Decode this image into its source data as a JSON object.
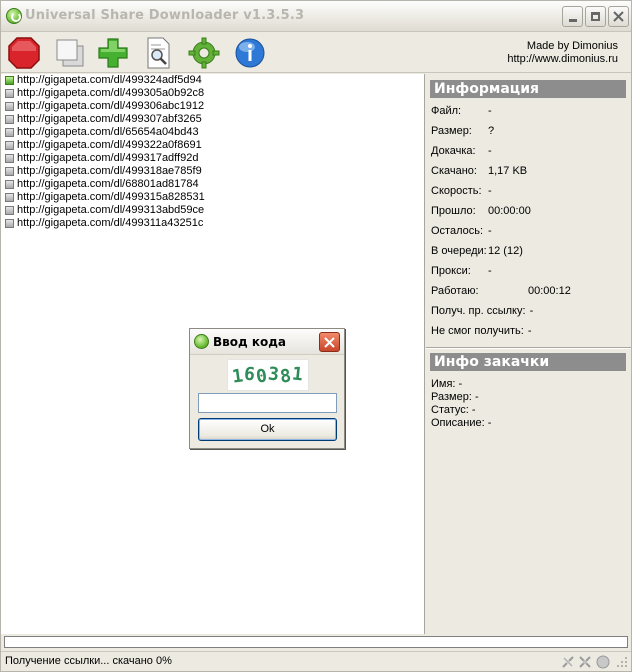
{
  "window": {
    "title": "Universal Share Downloader v1.3.5.3"
  },
  "toolbar": {
    "tools": [
      {
        "name": "stop-icon",
        "color": "#d9242b"
      },
      {
        "name": "copy-icon",
        "color": "#c8c8c8"
      },
      {
        "name": "add-icon",
        "color": "#46b030"
      },
      {
        "name": "search-document-icon",
        "color": "#9aa3b0"
      },
      {
        "name": "settings-gear-icon",
        "color": "#62b23a"
      },
      {
        "name": "globe-info-icon",
        "color": "#2e79d6"
      }
    ],
    "made_by_line1": "Made by Dimonius",
    "made_by_line2": "http://www.dimonius.ru"
  },
  "links": [
    {
      "url": "http://gigapeta.com/dl/499324adf5d94",
      "active": true
    },
    {
      "url": "http://gigapeta.com/dl/499305a0b92c8",
      "active": false
    },
    {
      "url": "http://gigapeta.com/dl/499306abc1912",
      "active": false
    },
    {
      "url": "http://gigapeta.com/dl/499307abf3265",
      "active": false
    },
    {
      "url": "http://gigapeta.com/dl/65654a04bd43",
      "active": false
    },
    {
      "url": "http://gigapeta.com/dl/499322a0f8691",
      "active": false
    },
    {
      "url": "http://gigapeta.com/dl/499317adff92d",
      "active": false
    },
    {
      "url": "http://gigapeta.com/dl/499318ae785f9",
      "active": false
    },
    {
      "url": "http://gigapeta.com/dl/68801ad81784",
      "active": false
    },
    {
      "url": "http://gigapeta.com/dl/499315a828531",
      "active": false
    },
    {
      "url": "http://gigapeta.com/dl/499313abd59ce",
      "active": false
    },
    {
      "url": "http://gigapeta.com/dl/499311a43251c",
      "active": false
    }
  ],
  "info": {
    "header": "Информация",
    "rows": [
      {
        "label": "Файл:",
        "value": "-"
      },
      {
        "label": "Размер:",
        "value": "?"
      },
      {
        "label": "Докачка:",
        "value": "-"
      },
      {
        "label": "Скачано:",
        "value": "1,17 KB"
      },
      {
        "label": "Скорость:",
        "value": "-"
      },
      {
        "label": "Прошло:",
        "value": "00:00:00"
      },
      {
        "label": "Осталось:",
        "value": "-"
      },
      {
        "label": "В очереди:",
        "value": "12 (12)"
      },
      {
        "label": "Прокси:",
        "value": "-"
      },
      {
        "label": "Работаю:",
        "value": "00:00:12"
      },
      {
        "label": "Получ. пр. ссылку:",
        "value": "-"
      },
      {
        "label": "Не смог получить:",
        "value": "-"
      }
    ]
  },
  "download_info": {
    "header": "Инфо закачки",
    "rows": [
      {
        "label": "Имя:",
        "value": "-"
      },
      {
        "label": "Размер:",
        "value": "-"
      },
      {
        "label": "Статус:",
        "value": "-"
      },
      {
        "label": "Описание:",
        "value": "-"
      }
    ]
  },
  "dialog": {
    "title": "Ввод кода",
    "captcha_text": "160381",
    "input_value": "",
    "ok_label": "Ok"
  },
  "progress": {
    "fraction": 0
  },
  "status": {
    "text": "Получение ссылки... скачано 0%"
  },
  "tray_icons": [
    "network-disconnected-icon",
    "tools-icon",
    "status-light-icon",
    "resize-grip-icon"
  ]
}
